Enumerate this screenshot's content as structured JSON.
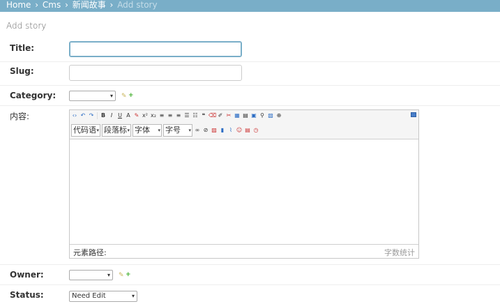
{
  "breadcrumb": {
    "home": "Home",
    "sep": "›",
    "app": "Cms",
    "model": "新闻故事",
    "current": "Add story"
  },
  "page_title": "Add story",
  "fields": {
    "title": {
      "label": "Title:",
      "value": ""
    },
    "slug": {
      "label": "Slug:",
      "value": ""
    },
    "category": {
      "label": "Category:",
      "selected": ""
    },
    "content": {
      "label": "内容:"
    },
    "owner": {
      "label": "Owner:",
      "selected": ""
    },
    "status": {
      "label": "Status:",
      "selected": "Need Edit"
    }
  },
  "editor": {
    "font_combos": [
      "代码语",
      "段落标",
      "字体",
      "字号"
    ],
    "status_path_label": "元素路径:",
    "word_count_label": "字数统计"
  },
  "icons": {
    "change": "pencil-icon",
    "add": "plus-icon",
    "colors": {
      "pencil": "#c9b45a",
      "plus": "#3fae2a",
      "header": "#79aec8"
    }
  }
}
